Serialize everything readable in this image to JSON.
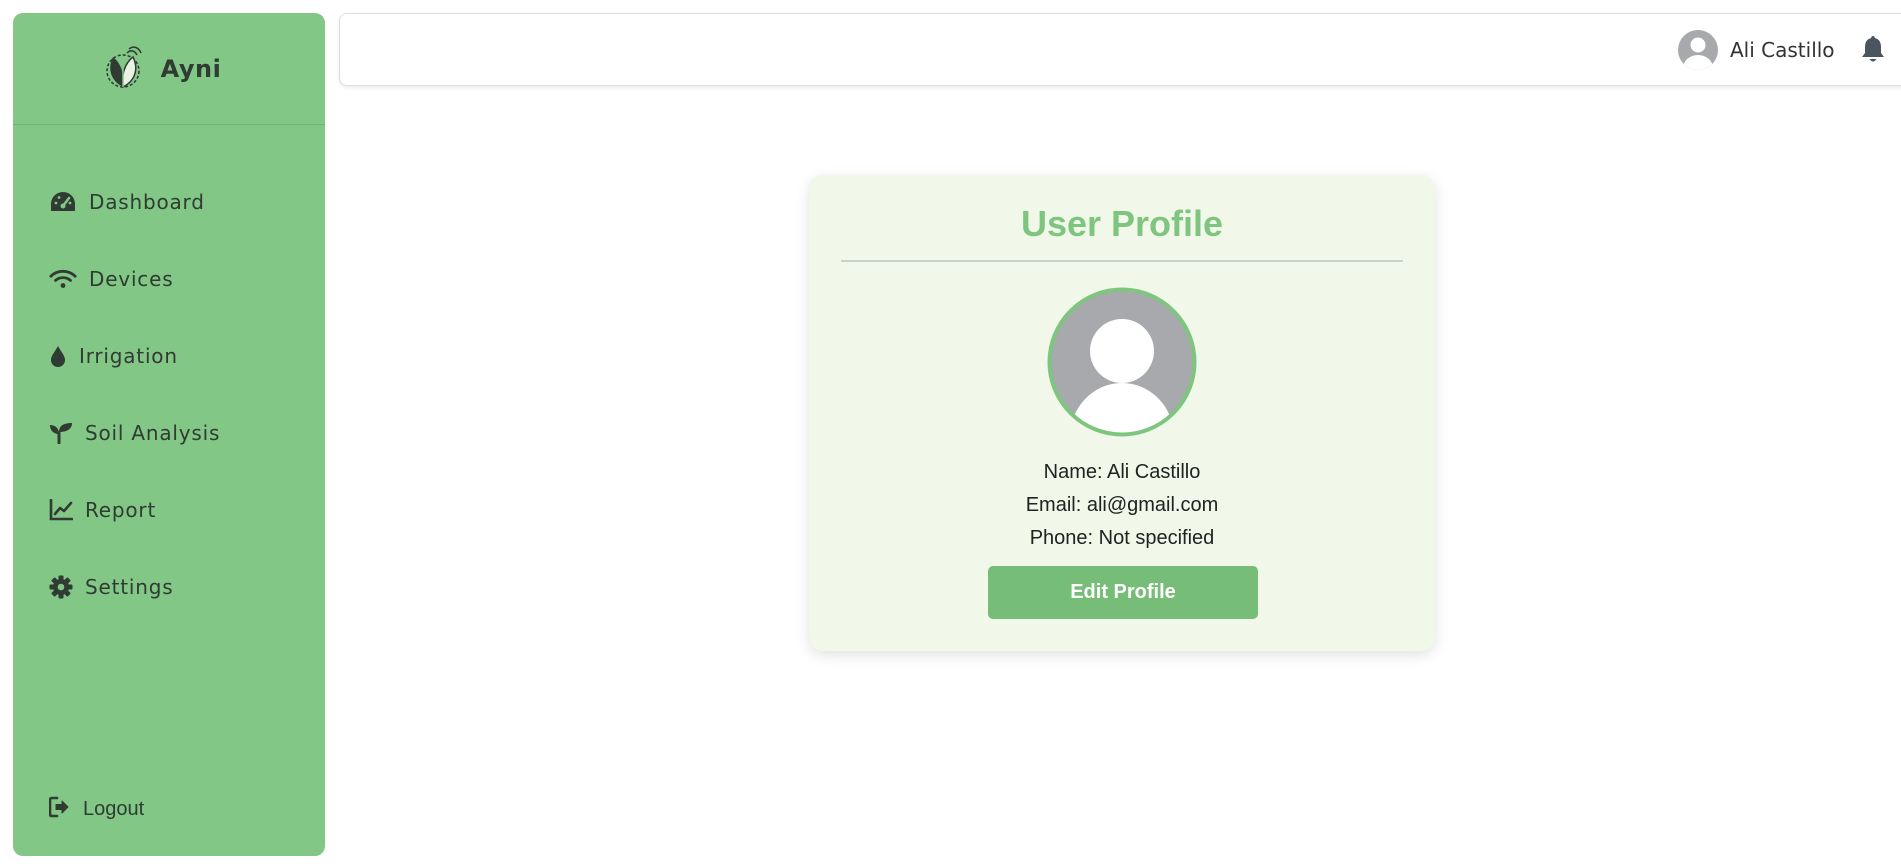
{
  "brand": {
    "name": "Ayni",
    "logo_icon": "leaf-logo-icon"
  },
  "sidebar": {
    "items": [
      {
        "label": "Dashboard",
        "icon": "gauge-icon"
      },
      {
        "label": "Devices",
        "icon": "wifi-icon"
      },
      {
        "label": "Irrigation",
        "icon": "droplet-icon"
      },
      {
        "label": "Soil Analysis",
        "icon": "seedling-icon"
      },
      {
        "label": "Report",
        "icon": "line-chart-icon"
      },
      {
        "label": "Settings",
        "icon": "gear-icon"
      }
    ],
    "logout_label": "Logout"
  },
  "header": {
    "user_name": "Ali Castillo",
    "notification_icon": "bell-icon"
  },
  "profile": {
    "title": "User Profile",
    "name_line": "Name: Ali Castillo",
    "email_line": "Email: ali@gmail.com",
    "phone_line": "Phone: Not specified",
    "edit_label": "Edit Profile"
  },
  "colors": {
    "sidebar_bg": "#82c785",
    "accent": "#7ec67f",
    "button_bg": "#76bd78",
    "card_bg": "#f1f7e9",
    "text_dark": "#2f3b33"
  }
}
